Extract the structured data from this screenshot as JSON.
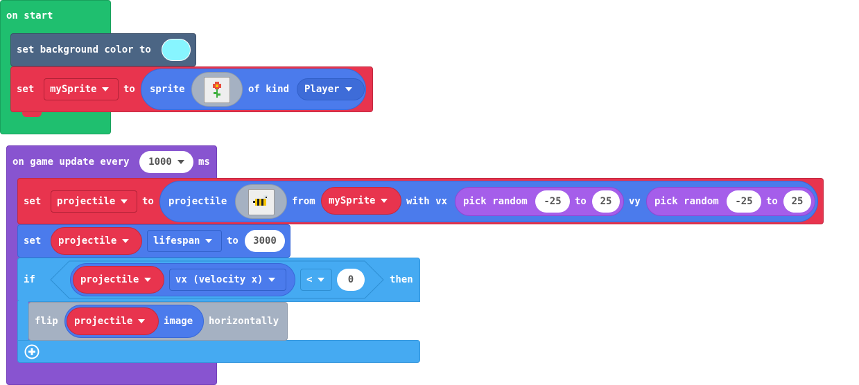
{
  "colors": {
    "events_green": "#1fbf6f",
    "scene_slate": "#4b6584",
    "sprites_blue": "#4b7bec",
    "variable_red": "#e8344e",
    "game_purple": "#8854d0",
    "math_violet": "#a55eea",
    "logic_blue": "#45aaf2",
    "images_gray": "#a5b1c2",
    "bg_swatch": "#87f5ff"
  },
  "on_start": {
    "hat_label": "on start",
    "set_bg": {
      "label": "set background color to",
      "swatch_color": "#87f5ff"
    },
    "set_sprite": {
      "set": "set",
      "variable": "mySprite",
      "to": "to",
      "sprite": "sprite",
      "image_icon": "flower-sprite-icon",
      "of_kind": "of kind",
      "kind": "Player"
    }
  },
  "game_update": {
    "hat_prefix": "on game update every",
    "interval": "1000",
    "unit": "ms",
    "set_projectile": {
      "set": "set",
      "variable": "projectile",
      "to": "to",
      "projectile": "projectile",
      "image_icon": "bee-sprite-icon",
      "from": "from",
      "source": "mySprite",
      "with_vx": "with vx",
      "pick_random_1": "pick random",
      "min_1": "-25",
      "to_1": "to",
      "max_1": "25",
      "vy": "vy",
      "pick_random_2": "pick random",
      "min_2": "-25",
      "to_2": "to",
      "max_2": "25"
    },
    "set_lifespan": {
      "set": "set",
      "variable": "projectile",
      "property": "lifespan",
      "to": "to",
      "value": "3000"
    },
    "if_block": {
      "if": "if",
      "variable": "projectile",
      "property": "vx (velocity x)",
      "operator": "<",
      "value": "0",
      "then": "then",
      "flip": {
        "flip": "flip",
        "variable": "projectile",
        "image": "image",
        "horizontally": "horizontally"
      },
      "add_icon": "plus-circle-icon"
    }
  }
}
